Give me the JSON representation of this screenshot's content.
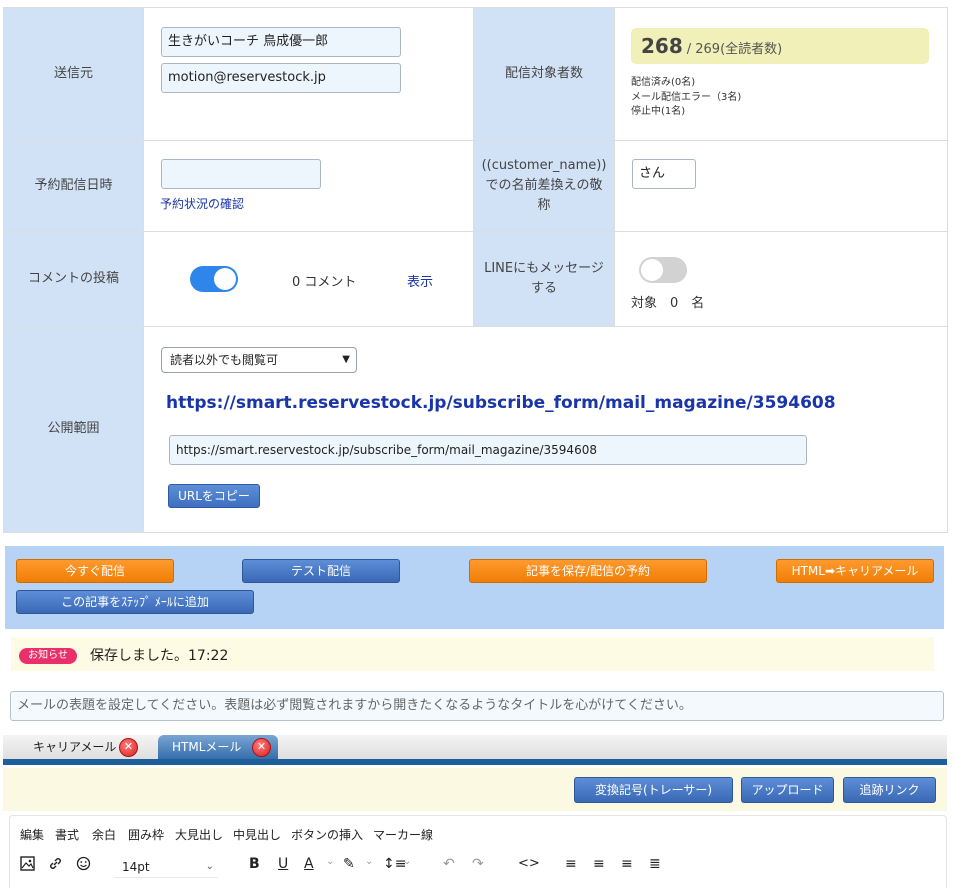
{
  "form": {
    "sender": {
      "label": "送信元",
      "name_value": "生きがいコーチ 鳥成優一郎",
      "email_value": "motion@reservestock.jp"
    },
    "recipients": {
      "label": "配信対象者数",
      "count": "268",
      "total": "/ 269(全読者数)",
      "sent": "配信済み(0名)",
      "error_link": "メール配信エラー（3名)",
      "stopped": "停止中(1名)"
    },
    "schedule": {
      "label": "予約配信日時",
      "value": "",
      "check_link": "予約状況の確認"
    },
    "honorific": {
      "label": "((customer_name))での名前差換えの敬称",
      "value": "さん"
    },
    "comments": {
      "label": "コメントの投稿",
      "toggle_on": true,
      "count_text": "0 コメント",
      "show_link": "表示"
    },
    "line": {
      "label": "LINEにもメッセージする",
      "toggle_on": false,
      "target_text": "対象　0　名"
    },
    "visibility": {
      "label": "公開範囲",
      "selected": "読者以外でも閲覧可",
      "url_large": "https://smart.reservestock.jp/subscribe_form/mail_magazine/3594608",
      "url_field": "https://smart.reservestock.jp/subscribe_form/mail_magazine/3594608",
      "copy_button": "URLをコピー"
    }
  },
  "actions": {
    "send_now": "今すぐ配信",
    "test_send": "テスト配信",
    "save_schedule": "記事を保存/配信の予約",
    "html_carrier": "HTML➡キャリアメール",
    "add_step": "この記事をｽﾃｯﾌﾟ ﾒｰﾙに追加"
  },
  "notice": {
    "badge": "お知らせ",
    "message": "保存しました。17:22"
  },
  "subject": {
    "placeholder": "メールの表題を設定してください。表題は必ず閲覧されますから開きたくなるようなタイトルを心がけてください。"
  },
  "tabs": [
    {
      "label": "キャリアメール",
      "active": false
    },
    {
      "label": "HTMLメール",
      "active": true
    }
  ],
  "editor_toolbar": {
    "convert_button": "変換記号(トレーサー)",
    "upload_button": "アップロード",
    "tracking_button": "追跡リンク"
  },
  "editor": {
    "menus": [
      "編集",
      "書式",
      "余白",
      "囲み枠",
      "大見出し",
      "中見出し",
      "ボタンの挿入",
      "マーカー線"
    ],
    "font_size": "14pt",
    "icons": [
      "image-icon",
      "link-icon",
      "emoji-icon",
      "bold-icon",
      "underline-icon",
      "text-color-icon",
      "highlight-icon",
      "line-height-icon",
      "undo-icon",
      "redo-icon",
      "source-code-icon",
      "align-left-icon",
      "align-center-icon",
      "align-right-icon",
      "align-justify-icon"
    ]
  },
  "colors": {
    "label_bg": "#d2e2f6",
    "accent_blue": "#2f86ea",
    "orange": "#f07e05",
    "link": "#1a35a8",
    "badge": "#e8316b"
  }
}
